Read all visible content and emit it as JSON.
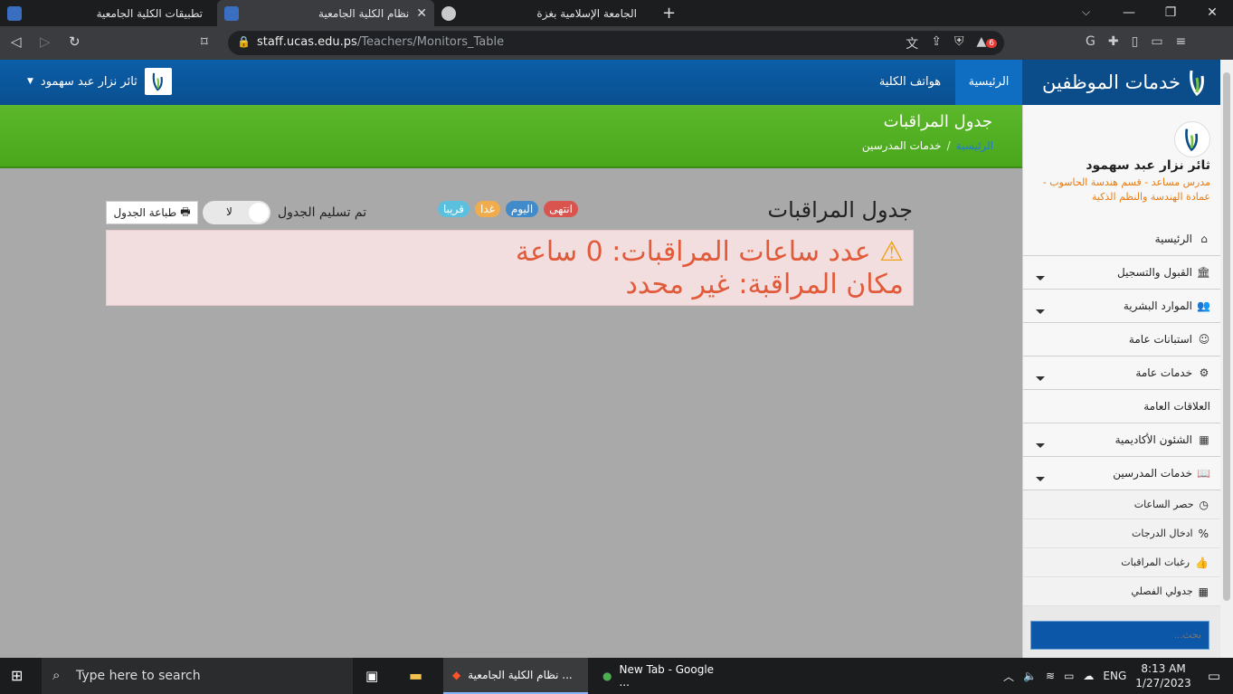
{
  "browser": {
    "tabs": [
      {
        "title": "تطبيقات الكلية الجامعية",
        "active": false
      },
      {
        "title": "نظام الكلية الجامعية",
        "active": true
      },
      {
        "title": "الجامعة الإسلامية بغزة",
        "active": false
      }
    ],
    "url_host": "staff.ucas.edu.ps",
    "url_path": "/Teachers/Monitors_Table",
    "brave_badge": "6"
  },
  "topnav": {
    "brand": "خدمات الموظفين",
    "home": "الرئيسية",
    "phones": "هواتف الكلية",
    "user": "ثائر نزار عبد سهمود"
  },
  "header": {
    "title": "جدول المراقبات",
    "breadcrumb_home": "الرئيسية",
    "breadcrumb_sep": "/",
    "breadcrumb_current": "خدمات المدرسين"
  },
  "profile": {
    "name": "ثائر نزار عبد سهمود",
    "role": "مدرس مساعد - قسم هندسة الحاسوب - عمادة الهندسة والنظم الذكية"
  },
  "sidebar": {
    "items": [
      {
        "label": "الرئيسية",
        "icon": "home-icon"
      },
      {
        "label": "القبول والتسجيل",
        "icon": "bank-icon"
      },
      {
        "label": "الموارد البشرية",
        "icon": "users-icon"
      },
      {
        "label": "استبانات عامة",
        "icon": "smile-icon"
      },
      {
        "label": "خدمات عامة",
        "icon": "cogs-icon"
      },
      {
        "label": "العلاقات العامة",
        "icon": ""
      },
      {
        "label": "الشئون الأكاديمية",
        "icon": "building-icon"
      },
      {
        "label": "خدمات المدرسين",
        "icon": "book-icon"
      }
    ],
    "subitems": [
      {
        "label": "حصر الساعات",
        "icon": "clock-icon"
      },
      {
        "label": "ادخال الدرجات",
        "icon": "percent-icon"
      },
      {
        "label": "رغبات المراقبات",
        "icon": "thumbs-up-icon"
      },
      {
        "label": "جدولي الفصلي",
        "icon": "calendar-icon"
      }
    ],
    "search_placeholder": "بحث..."
  },
  "content": {
    "title": "جدول المراقبات",
    "labels": [
      {
        "text": "قريبا",
        "color": "#5bc0de"
      },
      {
        "text": "غدا",
        "color": "#f0ad4e"
      },
      {
        "text": "اليوم",
        "color": "#428bca"
      },
      {
        "text": "انتهى",
        "color": "#d9534f"
      }
    ],
    "toggle_label": "تم تسليم الجدول",
    "toggle_value": "لا",
    "print_button": "طباعة الجدول",
    "alert_line1": "عدد ساعات المراقبات: 0 ساعة",
    "alert_line2": "مكان المراقبة: غير محدد"
  },
  "taskbar": {
    "search_placeholder": "Type here to search",
    "apps": [
      {
        "title": "نظام الكلية الجامعية ..."
      },
      {
        "title": "New Tab - Google ..."
      }
    ],
    "language": "ENG",
    "time": "8:13 AM",
    "date": "1/27/2023"
  }
}
